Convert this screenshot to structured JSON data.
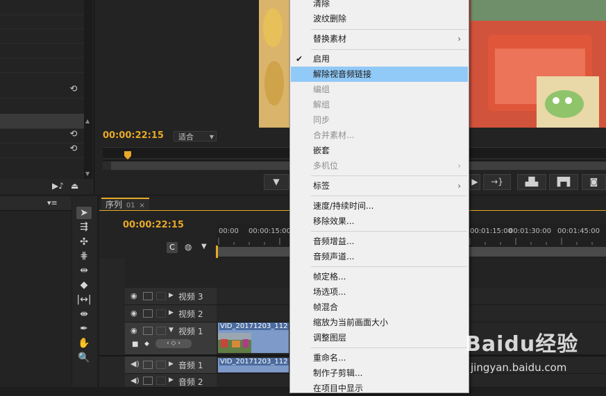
{
  "program_monitor": {
    "timecode": "00:00:22:15",
    "fit": "适合"
  },
  "sequence": {
    "tab_label": "序列",
    "tab_number": "01",
    "timecode": "00:00:22:15",
    "ruler_labels": [
      "00:00",
      "00:00:15:00",
      "00:01:15:00",
      "00:01:30:00",
      "00:01:45:00"
    ]
  },
  "tracks": {
    "video": [
      {
        "name": "视频 3"
      },
      {
        "name": "视频 2"
      },
      {
        "name": "视频 1",
        "clip": "VID_20171203_112"
      }
    ],
    "audio": [
      {
        "name": "音频 1",
        "clip": "VID_20171203_112"
      },
      {
        "name": "音频 2"
      }
    ]
  },
  "context_menu": {
    "items": [
      {
        "label": "清除",
        "state": "normal"
      },
      {
        "label": "波纹删除",
        "state": "normal"
      },
      {
        "label": "替换素材",
        "state": "normal",
        "submenu": true
      },
      {
        "label": "启用",
        "state": "checked"
      },
      {
        "label": "解除视音频链接",
        "state": "highlighted"
      },
      {
        "label": "编组",
        "state": "disabled"
      },
      {
        "label": "解组",
        "state": "disabled"
      },
      {
        "label": "同步",
        "state": "disabled"
      },
      {
        "label": "合并素材...",
        "state": "disabled"
      },
      {
        "label": "嵌套",
        "state": "normal"
      },
      {
        "label": "多机位",
        "state": "disabled",
        "submenu": true
      },
      {
        "label": "标签",
        "state": "normal",
        "submenu": true
      },
      {
        "label": "速度/持续时间...",
        "state": "normal"
      },
      {
        "label": "移除效果...",
        "state": "normal"
      },
      {
        "label": "音频增益...",
        "state": "normal"
      },
      {
        "label": "音频声道...",
        "state": "normal"
      },
      {
        "label": "帧定格...",
        "state": "normal"
      },
      {
        "label": "场选项...",
        "state": "normal"
      },
      {
        "label": "帧混合",
        "state": "normal"
      },
      {
        "label": "缩放为当前画面大小",
        "state": "normal"
      },
      {
        "label": "调整图层",
        "state": "normal"
      },
      {
        "label": "重命名...",
        "state": "normal"
      },
      {
        "label": "制作子剪辑...",
        "state": "normal"
      },
      {
        "label": "在项目中显示",
        "state": "normal"
      }
    ]
  },
  "watermark": {
    "logo": "Baidu经验",
    "url": "jingyan.baidu.com"
  },
  "colors": {
    "timecode": "#e8a928",
    "menu_highlight": "#91c9f7",
    "clip_video": "#7d9ac8"
  }
}
